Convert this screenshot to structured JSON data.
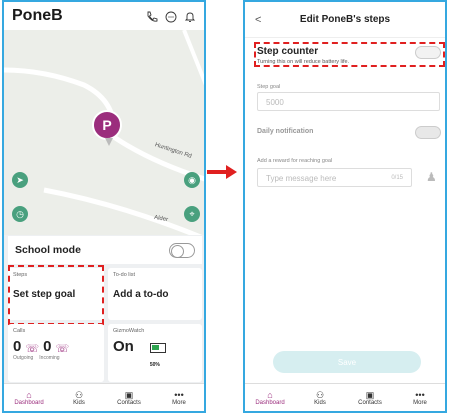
{
  "left": {
    "brand": "PoneB",
    "map": {
      "road_label_1": "Huntington Rd",
      "road_label_2": "Alder",
      "pin_letter": "P"
    },
    "school_mode": "School mode",
    "steps": {
      "caption": "Steps",
      "title": "Set step goal"
    },
    "todo": {
      "caption": "To-do list",
      "title": "Add a to-do"
    },
    "calls": {
      "caption": "Calls",
      "outgoing_count": "0",
      "incoming_count": "0",
      "outgoing_label": "Outgoing",
      "incoming_label": "Incoming"
    },
    "watch": {
      "caption": "GizmoWatch",
      "status": "On",
      "battery": "50%"
    }
  },
  "right": {
    "title": "Edit PoneB's steps",
    "back": "<",
    "step_counter": "Step counter",
    "step_counter_hint": "Turning this on will reduce battery life.",
    "step_goal_label": "Step goal",
    "step_goal_placeholder": "5000",
    "daily_notification": "Daily notification",
    "reward_label": "Add a reward for reaching goal",
    "reward_placeholder": "Type message here",
    "reward_counter": "0/15",
    "save": "Save"
  },
  "tabs": [
    "Dashboard",
    "Kids",
    "Contacts",
    "More"
  ],
  "colors": {
    "accent": "#9b2d7d",
    "frame": "#35a8e0",
    "highlight": "#e02020"
  }
}
